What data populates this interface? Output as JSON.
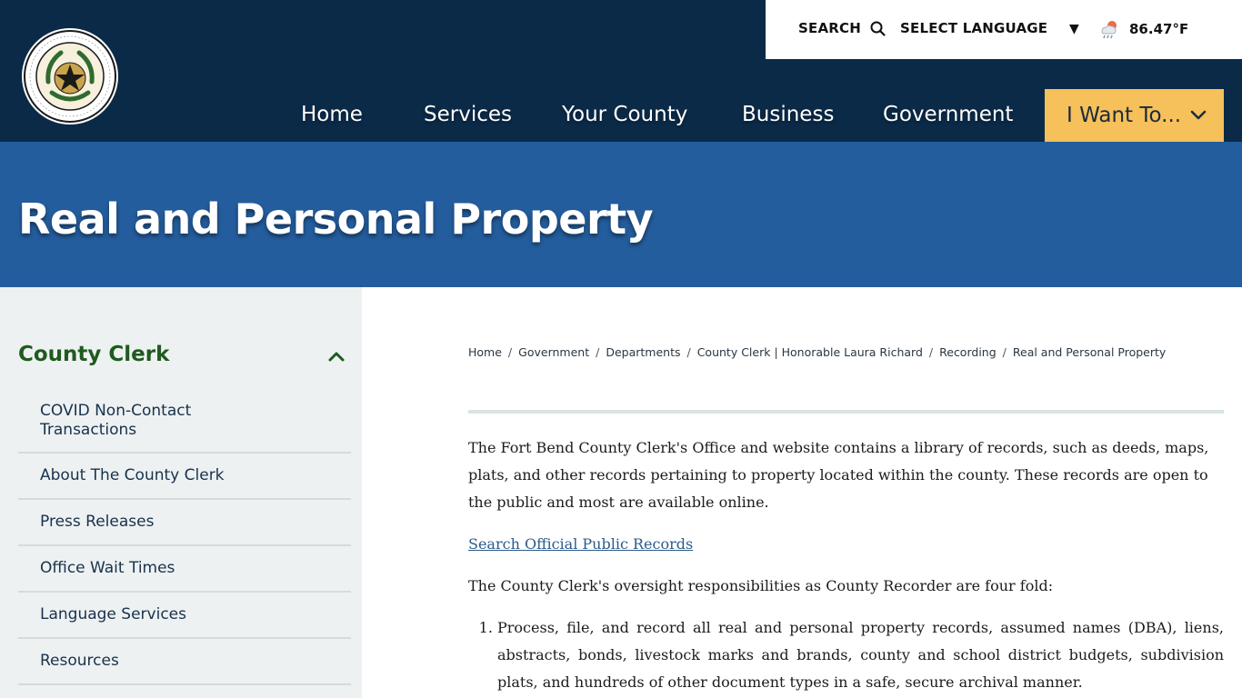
{
  "header": {
    "seal_alt": "Fort Bend County seal",
    "utility": {
      "search_label": "SEARCH",
      "language_label": "SELECT LANGUAGE",
      "temperature": "86.47°F"
    },
    "nav": [
      {
        "label": "Home"
      },
      {
        "label": "Services"
      },
      {
        "label": "Your County"
      },
      {
        "label": "Business"
      },
      {
        "label": "Government"
      }
    ],
    "i_want_to": "I Want To..."
  },
  "banner": {
    "title": "Real and Personal Property"
  },
  "sidebar": {
    "title": "County Clerk",
    "items": [
      {
        "label": "COVID Non-Contact Transactions"
      },
      {
        "label": "About The County Clerk"
      },
      {
        "label": "Press Releases"
      },
      {
        "label": "Office Wait Times"
      },
      {
        "label": "Language Services"
      },
      {
        "label": "Resources"
      }
    ]
  },
  "breadcrumb": [
    {
      "label": "Home"
    },
    {
      "label": "Government"
    },
    {
      "label": "Departments"
    },
    {
      "label": "County Clerk | Honorable Laura Richard"
    },
    {
      "label": "Recording"
    },
    {
      "label": "Real and Personal Property"
    }
  ],
  "content": {
    "intro": "The Fort Bend County Clerk's Office and website contains a library of records, such as deeds, maps, plats, and other records pertaining to property located within the county. These records are open to the public and most are available online.",
    "link": "Search Official Public Records",
    "lead": "The County Clerk's oversight responsibilities as County Recorder are four fold:",
    "list": [
      "Process, file, and record all real and personal property records, assumed names (DBA), liens, abstracts, bonds, livestock marks and brands, county and school district budgets, subdivision plats, and hundreds of other document types in a safe, secure archival manner."
    ]
  },
  "colors": {
    "header_bg": "#0b2a48",
    "banner_bg": "#245d9d",
    "accent_yellow": "#f6c05a",
    "sidebar_title_green": "#1f5a1f",
    "sidebar_bg": "#eef1f1"
  }
}
